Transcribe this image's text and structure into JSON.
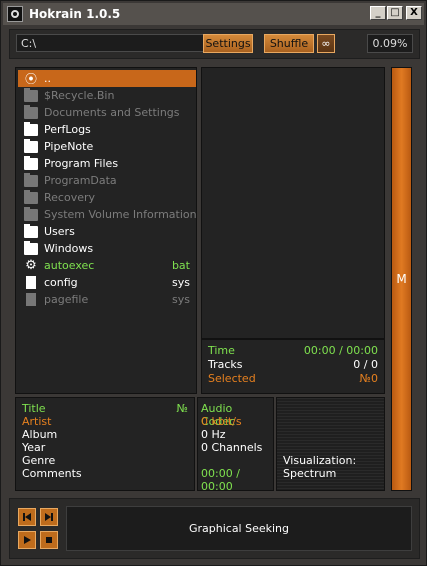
{
  "window": {
    "title": "Hokrain 1.0.5",
    "min_glyph": "_",
    "max_glyph": "□",
    "close_glyph": "X"
  },
  "toolbar": {
    "path": "C:\\",
    "settings_label": "Settings",
    "shuffle_label": "Shuffle",
    "repeat_glyph": "∞",
    "progress": "0.09%"
  },
  "files": [
    {
      "name": "..",
      "ext": "",
      "icon": "up-folder-icon",
      "style": "selected"
    },
    {
      "name": "$Recycle.Bin",
      "ext": "",
      "icon": "folder-icon",
      "style": "dim"
    },
    {
      "name": "Documents and Settings",
      "ext": "",
      "icon": "folder-icon",
      "style": "dim"
    },
    {
      "name": "PerfLogs",
      "ext": "",
      "icon": "folder-icon",
      "style": "normal"
    },
    {
      "name": "PipeNote",
      "ext": "",
      "icon": "folder-icon",
      "style": "normal"
    },
    {
      "name": "Program Files",
      "ext": "",
      "icon": "folder-icon",
      "style": "normal"
    },
    {
      "name": "ProgramData",
      "ext": "",
      "icon": "folder-icon",
      "style": "dim"
    },
    {
      "name": "Recovery",
      "ext": "",
      "icon": "folder-icon",
      "style": "dim"
    },
    {
      "name": "System Volume Information",
      "ext": "",
      "icon": "folder-icon",
      "style": "dim"
    },
    {
      "name": "Users",
      "ext": "",
      "icon": "folder-icon",
      "style": "normal"
    },
    {
      "name": "Windows",
      "ext": "",
      "icon": "folder-icon",
      "style": "normal"
    },
    {
      "name": "autoexec",
      "ext": "bat",
      "icon": "gear-icon",
      "style": "green"
    },
    {
      "name": "config",
      "ext": "sys",
      "icon": "file-icon",
      "style": "normal"
    },
    {
      "name": "pagefile",
      "ext": "sys",
      "icon": "file-icon",
      "style": "dim"
    }
  ],
  "stats": {
    "time_label": "Time",
    "time_value": "00:00 / 00:00",
    "tracks_label": "Tracks",
    "tracks_value": "0 / 0",
    "selected_label": "Selected",
    "selected_value": "№0"
  },
  "mbar": {
    "label": "M"
  },
  "tags": {
    "title_label": "Title",
    "number_label": "№",
    "artist_label": "Artist",
    "album_label": "Album",
    "year_label": "Year",
    "genre_label": "Genre",
    "comments_label": "Comments"
  },
  "codec": {
    "header": "Audio Codec",
    "bitrate": "0 kbit/s",
    "samplerate": "0 Hz",
    "channels": "0 Channels",
    "time": "00:00 / 00:00"
  },
  "viz": {
    "line1": "Visualization:",
    "line2": "Spectrum"
  },
  "seek": {
    "label": "Graphical Seeking"
  },
  "colors": {
    "accent": "#c8671a",
    "green": "#7fe14f",
    "orange": "#e6801f"
  }
}
